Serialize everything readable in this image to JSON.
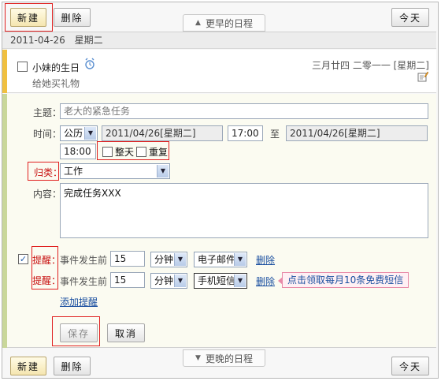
{
  "toolbar": {
    "new_label": "新建",
    "delete_label": "删除",
    "today_label": "今天",
    "earlier_label": "更早的日程",
    "later_label": "更晚的日程"
  },
  "day": {
    "date": "2011-04-26",
    "weekday": "星期二"
  },
  "event": {
    "title": "小妹的生日",
    "note": "给她买礼物",
    "lunar_date": "三月廿四 二零一一 [星期二]"
  },
  "form": {
    "subject_label": "主题：",
    "subject_placeholder": "老大的紧急任务",
    "time_label": "时间：",
    "calendar_type": "公历",
    "start_date": "2011/04/26[星期二]",
    "start_time": "17:00",
    "to_label": "至",
    "end_date": "2011/04/26[星期二]",
    "end_time": "18:00",
    "allday_label": "整天",
    "repeat_label": "重复",
    "category_label": "归类：",
    "category_value": "工作",
    "content_label": "内容：",
    "content_value": "完成任务XXX",
    "reminders": [
      {
        "label": "提醒：",
        "prefix": "事件发生前",
        "amount": "15",
        "unit": "分钟",
        "channel": "电子邮件",
        "delete_label": "删除"
      },
      {
        "label": "提醒：",
        "prefix": "事件发生前",
        "amount": "15",
        "unit": "分钟",
        "channel": "手机短信",
        "delete_label": "删除",
        "promo": "点击领取每月10条免费短信"
      }
    ],
    "add_reminder_label": "添加提醒",
    "save_label": "保存",
    "cancel_label": "取消"
  },
  "colors": {
    "highlight": "#e02020",
    "link": "#1a4fa0",
    "event_bar": "#f0c040",
    "form_bar": "#c9d79a"
  }
}
